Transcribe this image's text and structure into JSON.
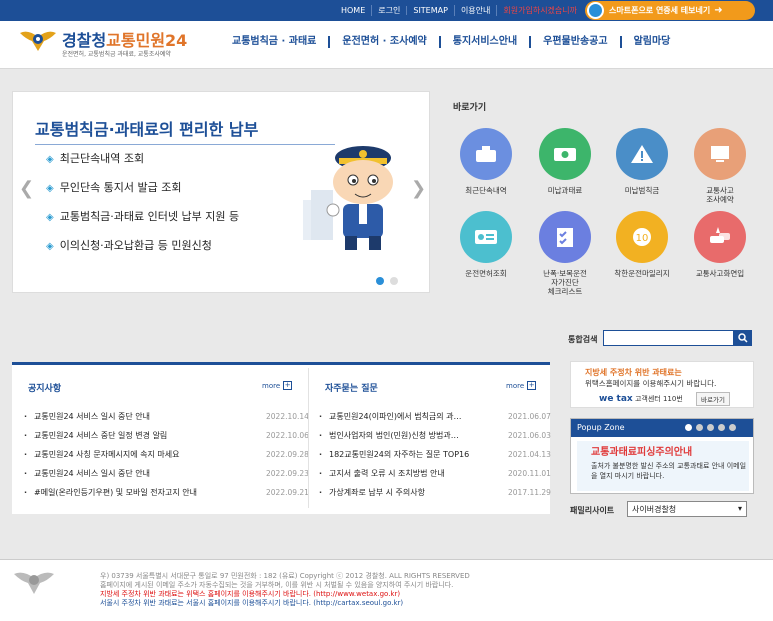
{
  "topbar": {
    "links": [
      "HOME",
      "로그인",
      "SITEMAP",
      "이용안내",
      "회원가입하시겠습니까"
    ],
    "smart_button": "스마트폰으로 연중세 테보네기"
  },
  "header": {
    "logo_main": "경찰청",
    "logo_accent": "교통민원24",
    "logo_sub": "운전면허, 교통범칙금 과태료, 교통조사예약",
    "nav": [
      "교통범칙금 · 과태료",
      "운전면허 · 조사예약",
      "통지서비스안내",
      "우편물반송공고",
      "알림마당"
    ]
  },
  "slider": {
    "title": "교통범칙금·과태료의 편리한 납부",
    "items": [
      "최근단속내역 조회",
      "무인단속 통지서 발급 조회",
      "교통범칙금·과태료 인터넷 납부 지원 등",
      "이의신청·과오납환급 등 민원신청"
    ],
    "bullet": "◈",
    "prev": "❮",
    "next": "❯"
  },
  "quick": {
    "title": "바로가기",
    "items": [
      {
        "label": "최근단속내역",
        "color": "#6b8fe0",
        "icon": "camera-icon"
      },
      {
        "label": "미납과태료",
        "color": "#3db56b",
        "icon": "money-icon"
      },
      {
        "label": "미납범칙금",
        "color": "#4a8ec8",
        "icon": "warning-icon"
      },
      {
        "label": "교통사고\n조사예약",
        "color": "#e8a078",
        "icon": "computer-icon"
      },
      {
        "label": "운전면허조회",
        "color": "#4cbfcf",
        "icon": "license-icon"
      },
      {
        "label": "난폭·보복운전\n자가진단\n체크리스트",
        "color": "#6b7fe0",
        "icon": "checklist-icon"
      },
      {
        "label": "착한운전마일리지",
        "color": "#f2b122",
        "icon": "mileage-icon"
      },
      {
        "label": "교통사고화연입",
        "color": "#e86b6b",
        "icon": "accident-icon"
      }
    ]
  },
  "search": {
    "label": "통합검색",
    "placeholder": ""
  },
  "notice": {
    "title": "공지사항",
    "more": "more",
    "items": [
      {
        "title": "교통민원24 서비스 일시 중단 안내",
        "date": "2022.10.14"
      },
      {
        "title": "교통민원24 서비스 중단 일정 변경 알림",
        "date": "2022.10.06"
      },
      {
        "title": "교통민원24 사칭 문자메시지에 속지 마세요",
        "date": "2022.09.28"
      },
      {
        "title": "교통민원24 서비스 일시 중단 안내",
        "date": "2022.09.23"
      },
      {
        "title": "#메일(온라인등기우편) 및 모바일 전자고지 안내",
        "date": "2022.09.21"
      }
    ]
  },
  "faq": {
    "title": "자주묻는 질문",
    "more": "more",
    "items": [
      {
        "title": "교통민원24(이파인)에서 범칙금의 과…",
        "date": "2021.06.07"
      },
      {
        "title": "법인사업자의 법인(민원)신청 방법과…",
        "date": "2021.06.03"
      },
      {
        "title": "182교통민원24의 자주하는 질문 TOP16",
        "date": "2021.04.13"
      },
      {
        "title": "고지서 출력 오류 시 조치방법 안내",
        "date": "2020.11.01"
      },
      {
        "title": "가상계좌로 납부 시 주의사항",
        "date": "2017.11.29"
      }
    ]
  },
  "banner_wetax": {
    "line1": "지방세 주정차 위반 과태료는",
    "line2": "위택스홈페이지를 이용해주시기 바랍니다.",
    "brand": "we tax",
    "contact": "고객센터 110번",
    "shortcut": "바로가기"
  },
  "popup": {
    "title": "Popup Zone",
    "headline": "교통과태료피싱주의안내",
    "body": "출처가 불분명한 발신 주소의 교통과태료 안내 이메일을 열지 마시기 바랍니다."
  },
  "family": {
    "label": "패밀리사이트",
    "selected": "사이버경찰청"
  },
  "footer": {
    "address": "우) 03739 서울특별시 서대문구 통일로 97  민원전화 : 182 (유료)     Copyright ⓒ 2012 경찰청. ALL RIGHTS RESERVED",
    "notice": "홈페이지에 게시된 이메일 주소가 자동수집되는 것을 거부하며, 이를 위반 시 처벌될 수 있음을 양지하여 주시기 바랍니다.",
    "red_line": "지방세 주정차 위반 과태료는 위택스 홈페이지를 이용해주시기 바랍니다. (http://www.wetax.go.kr)",
    "blue_line": "서울시 주정차 위반 과태료는 서울시 홈페이지를 이용해주시기 바랍니다. (http://cartax.seoul.go.kr)"
  },
  "colors": {
    "brand": "#1d4f97",
    "accent": "#f29a1b",
    "alert": "#e03b3b"
  }
}
